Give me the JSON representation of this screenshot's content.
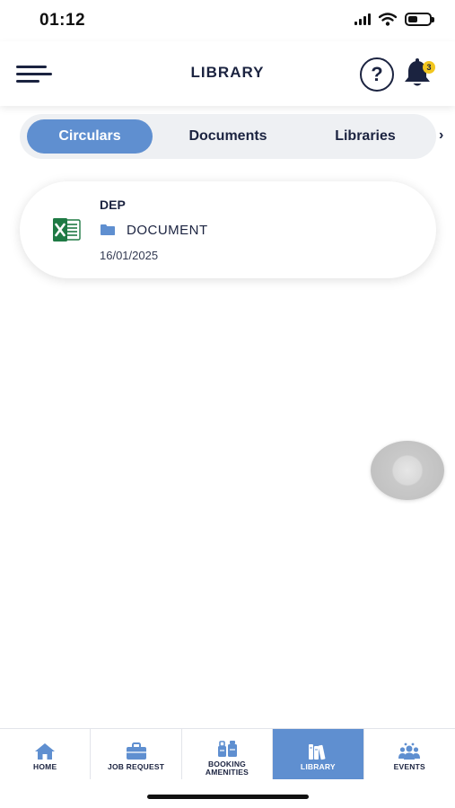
{
  "status_bar": {
    "time": "01:12",
    "battery_level": 0.45,
    "icons": [
      "cellular-signal-icon",
      "wifi-icon",
      "battery-icon"
    ]
  },
  "header": {
    "title": "LIBRARY",
    "help_icon": "question-circle-icon",
    "menu_icon": "hamburger-menu-icon",
    "notification_icon": "bell-icon",
    "notification_count": "3"
  },
  "tabs": {
    "items": [
      {
        "label": "Circulars",
        "active": true
      },
      {
        "label": "Documents",
        "active": false
      },
      {
        "label": "Libraries",
        "active": false
      }
    ],
    "scroll_arrow": "›"
  },
  "documents": [
    {
      "title": "DEP",
      "file_icon": "excel-file-icon",
      "folder_icon": "folder-icon",
      "folder": "DOCUMENT",
      "date": "16/01/2025"
    }
  ],
  "bottom_nav": {
    "items": [
      {
        "label": "HOME",
        "icon": "home-icon",
        "active": false
      },
      {
        "label": "JOB REQUEST",
        "icon": "briefcase-icon",
        "active": false
      },
      {
        "label": "BOOKING AMENITIES",
        "icon": "booking-amenities-icon",
        "active": false
      },
      {
        "label": "LIBRARY",
        "icon": "books-icon",
        "active": true
      },
      {
        "label": "EVENTS",
        "icon": "events-icon",
        "active": false
      }
    ]
  },
  "colors": {
    "accent": "#5f8fd0",
    "text_dark": "#1b2340",
    "badge": "#f2c61f",
    "excel_green": "#1f7a44"
  }
}
